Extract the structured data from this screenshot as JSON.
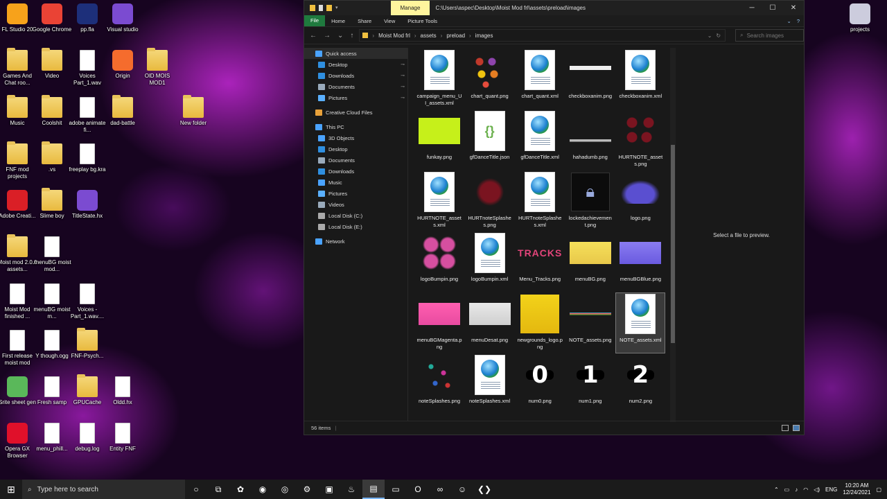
{
  "desktop": {
    "icons": [
      {
        "label": "FL Studio 20",
        "icon": "fl-studio-icon",
        "kind": "app",
        "color": "#f7a21b"
      },
      {
        "label": "Google Chrome",
        "icon": "chrome-icon",
        "kind": "app",
        "color": "#ea4335"
      },
      {
        "label": "pp.fla",
        "icon": "animate-file-icon",
        "kind": "app",
        "color": "#1d2f7a"
      },
      {
        "label": "Visual studio",
        "icon": "visual-studio-icon",
        "kind": "app",
        "color": "#7b4bd1"
      },
      {
        "label": "Games And Chat roo...",
        "icon": "folder-icon",
        "kind": "folder"
      },
      {
        "label": "Video",
        "icon": "folder-icon",
        "kind": "folder"
      },
      {
        "label": "Voices Part_1.wav",
        "icon": "audio-file-icon",
        "kind": "file"
      },
      {
        "label": "Origin",
        "icon": "origin-icon",
        "kind": "app",
        "color": "#f56c2d"
      },
      {
        "label": "OlD MOIS MOD1",
        "icon": "folder-icon",
        "kind": "folder"
      },
      {
        "label": "Music",
        "icon": "folder-icon",
        "kind": "folder"
      },
      {
        "label": "Coolshit",
        "icon": "folder-icon",
        "kind": "folder"
      },
      {
        "label": "adobe animate fi...",
        "icon": "animate-file-icon",
        "kind": "file"
      },
      {
        "label": "dad-battle",
        "icon": "folder-icon",
        "kind": "folder"
      },
      {
        "label": "New folder",
        "icon": "folder-icon",
        "kind": "folder"
      },
      {
        "label": "FNF mod projects",
        "icon": "folder-icon",
        "kind": "folder"
      },
      {
        "label": ".vs",
        "icon": "folder-icon",
        "kind": "folder"
      },
      {
        "label": "freeplay bg.kra",
        "icon": "krita-file-icon",
        "kind": "file"
      },
      {
        "label": "Adobe Creati...",
        "icon": "creative-cloud-icon",
        "kind": "app",
        "color": "#da1f26"
      },
      {
        "label": "Slime boy",
        "icon": "folder-icon",
        "kind": "folder"
      },
      {
        "label": "TitleState.hx",
        "icon": "vs-file-icon",
        "kind": "app",
        "color": "#7b4bd1"
      },
      {
        "label": "Moist mod 2.0.0 assets...",
        "icon": "folder-icon",
        "kind": "folder"
      },
      {
        "label": ".menuBG moist mod...",
        "icon": "krita-file-icon",
        "kind": "file"
      },
      {
        "label": "Moist Mod finished ...",
        "icon": "animate-file-icon",
        "kind": "file"
      },
      {
        "label": "menuBG moist m...",
        "icon": "krita-file-icon",
        "kind": "file"
      },
      {
        "label": "Voices - Part_1.wav....",
        "icon": "file-icon",
        "kind": "file"
      },
      {
        "label": "First release moist mod",
        "icon": "animate-file-icon",
        "kind": "file"
      },
      {
        "label": "Y though.ogg",
        "icon": "audio-file-icon",
        "kind": "file"
      },
      {
        "label": "FNF-Psych...",
        "icon": "folder-icon",
        "kind": "folder"
      },
      {
        "label": "Srite sheet gen",
        "icon": "sprite-sheet-icon",
        "kind": "app",
        "color": "#5ab85a"
      },
      {
        "label": "Fresh samp",
        "icon": "audio-file-icon",
        "kind": "file"
      },
      {
        "label": "GPUCache",
        "icon": "folder-icon",
        "kind": "folder"
      },
      {
        "label": "Oldd.hx",
        "icon": "archive-icon",
        "kind": "file"
      },
      {
        "label": "Opera GX Browser",
        "icon": "opera-gx-icon",
        "kind": "app",
        "color": "#e0102a"
      },
      {
        "label": "menu_phill...",
        "icon": "krita-file-icon",
        "kind": "file"
      },
      {
        "label": "debug.log",
        "icon": "text-file-icon",
        "kind": "file"
      },
      {
        "label": "Entity FNF",
        "icon": "archive-icon",
        "kind": "file"
      },
      {
        "label": "projects",
        "icon": "recycle-bin-icon",
        "kind": "app",
        "color": "#ccd"
      }
    ]
  },
  "explorer": {
    "manage_tab": "Manage",
    "path_title": "C:\\Users\\aspec\\Desktop\\Moist Mod frl\\assets\\preload\\images",
    "ribbon_tabs": [
      "File",
      "Home",
      "Share",
      "View",
      "Picture Tools"
    ],
    "breadcrumbs": [
      "Moist Mod frl",
      "assets",
      "preload",
      "images"
    ],
    "search_placeholder": "Search images",
    "nav": [
      {
        "label": "Quick access",
        "icon": "star-icon",
        "color": "#4aa3ff",
        "indent": 1,
        "pinned": false,
        "selected": true
      },
      {
        "label": "Desktop",
        "icon": "desktop-icon",
        "color": "#2f8fe0",
        "indent": 2,
        "pinned": true
      },
      {
        "label": "Downloads",
        "icon": "download-icon",
        "color": "#2f8fe0",
        "indent": 2,
        "pinned": true
      },
      {
        "label": "Documents",
        "icon": "document-icon",
        "color": "#9ab",
        "indent": 2,
        "pinned": true
      },
      {
        "label": "Pictures",
        "icon": "pictures-icon",
        "color": "#5ab0ff",
        "indent": 2,
        "pinned": true
      },
      {
        "label": "",
        "icon": "",
        "color": "",
        "indent": 0,
        "pinned": false
      },
      {
        "label": "Creative Cloud Files",
        "icon": "creative-cloud-icon",
        "color": "#e8a13a",
        "indent": 1,
        "pinned": false
      },
      {
        "label": "",
        "icon": "",
        "color": "",
        "indent": 0,
        "pinned": false
      },
      {
        "label": "This PC",
        "icon": "computer-icon",
        "color": "#4aa3ff",
        "indent": 1,
        "pinned": false
      },
      {
        "label": "3D Objects",
        "icon": "cube-icon",
        "color": "#4aa3ff",
        "indent": 2,
        "pinned": false
      },
      {
        "label": "Desktop",
        "icon": "desktop-icon",
        "color": "#2f8fe0",
        "indent": 2,
        "pinned": false
      },
      {
        "label": "Documents",
        "icon": "document-icon",
        "color": "#9ab",
        "indent": 2,
        "pinned": false
      },
      {
        "label": "Downloads",
        "icon": "download-icon",
        "color": "#2f8fe0",
        "indent": 2,
        "pinned": false
      },
      {
        "label": "Music",
        "icon": "music-icon",
        "color": "#4aa3ff",
        "indent": 2,
        "pinned": false
      },
      {
        "label": "Pictures",
        "icon": "pictures-icon",
        "color": "#5ab0ff",
        "indent": 2,
        "pinned": false
      },
      {
        "label": "Videos",
        "icon": "video-icon",
        "color": "#9ab",
        "indent": 2,
        "pinned": false
      },
      {
        "label": "Local Disk (C:)",
        "icon": "disk-icon",
        "color": "#aaa",
        "indent": 2,
        "pinned": false
      },
      {
        "label": "Local Disk (E:)",
        "icon": "disk-icon",
        "color": "#aaa",
        "indent": 2,
        "pinned": false
      },
      {
        "label": "",
        "icon": "",
        "color": "",
        "indent": 0,
        "pinned": false
      },
      {
        "label": "Network",
        "icon": "network-icon",
        "color": "#4aa3ff",
        "indent": 1,
        "pinned": false
      }
    ],
    "files": [
      {
        "name": "campaign_menu_UI_assets.xml",
        "kind": "xml"
      },
      {
        "name": "chart_quant.png",
        "kind": "png",
        "look": "dots"
      },
      {
        "name": "chart_quant.xml",
        "kind": "xml"
      },
      {
        "name": "checkboxanim.png",
        "kind": "png",
        "look": "checks"
      },
      {
        "name": "checkboxanim.xml",
        "kind": "xml"
      },
      {
        "name": "funkay.png",
        "kind": "png",
        "look": "funkay"
      },
      {
        "name": "gfDanceTitle.json",
        "kind": "json"
      },
      {
        "name": "gfDanceTitle.xml",
        "kind": "xml"
      },
      {
        "name": "hahadumb.png",
        "kind": "png",
        "look": "bar"
      },
      {
        "name": "HURTNOTE_assets.png",
        "kind": "png",
        "look": "hurt"
      },
      {
        "name": "HURTNOTE_assets.xml",
        "kind": "xml"
      },
      {
        "name": "HURTnoteSplashes.png",
        "kind": "png",
        "look": "hurtsplash"
      },
      {
        "name": "HURTnoteSplashes.xml",
        "kind": "xml"
      },
      {
        "name": "lockedachievement.png",
        "kind": "png",
        "look": "lock"
      },
      {
        "name": "logo.png",
        "kind": "png",
        "look": "logo"
      },
      {
        "name": "logoBumpin.png",
        "kind": "png",
        "look": "logos"
      },
      {
        "name": "logoBumpin.xml",
        "kind": "xml"
      },
      {
        "name": "Menu_Tracks.png",
        "kind": "png",
        "look": "tracks"
      },
      {
        "name": "menuBG.png",
        "kind": "png",
        "look": "yellow"
      },
      {
        "name": "menuBGBlue.png",
        "kind": "png",
        "look": "blue"
      },
      {
        "name": "menuBGMagenta.png",
        "kind": "png",
        "look": "magenta"
      },
      {
        "name": "menuDesat.png",
        "kind": "png",
        "look": "desat"
      },
      {
        "name": "newgrounds_logo.png",
        "kind": "png",
        "look": "newgrounds"
      },
      {
        "name": "NOTE_assets.png",
        "kind": "png",
        "look": "notes"
      },
      {
        "name": "NOTE_assets.xml",
        "kind": "xml",
        "selected": true
      },
      {
        "name": "noteSplashes.png",
        "kind": "png",
        "look": "splash"
      },
      {
        "name": "noteSplashes.xml",
        "kind": "xml"
      },
      {
        "name": "num0.png",
        "kind": "png",
        "look": "num0"
      },
      {
        "name": "num1.png",
        "kind": "png",
        "look": "num1"
      },
      {
        "name": "num2.png",
        "kind": "png",
        "look": "num2"
      }
    ],
    "tracks_text": "TRACKS",
    "num_glyphs": {
      "num0": "0",
      "num1": "1",
      "num2": "2"
    },
    "preview_text": "Select a file to preview.",
    "status_text": "56 items",
    "window_controls": [
      "─",
      "☐",
      "✕"
    ]
  },
  "taskbar": {
    "search_placeholder": "Type here to search",
    "apps": [
      {
        "icon": "cortana-icon",
        "glyph": "○"
      },
      {
        "icon": "task-view-icon",
        "glyph": "⧉"
      },
      {
        "icon": "fl-studio-icon",
        "glyph": "✿"
      },
      {
        "icon": "origin-icon",
        "glyph": "◉"
      },
      {
        "icon": "chrome-icon",
        "glyph": "◎"
      },
      {
        "icon": "settings-icon",
        "glyph": "⚙"
      },
      {
        "icon": "sprite-sheet-icon",
        "glyph": "▣"
      },
      {
        "icon": "steam-icon",
        "glyph": "♨"
      },
      {
        "icon": "file-explorer-icon",
        "glyph": "▤",
        "active": true
      },
      {
        "icon": "terminal-icon",
        "glyph": "▭"
      },
      {
        "icon": "opera-gx-icon",
        "glyph": "O"
      },
      {
        "icon": "visual-studio-icon",
        "glyph": "∞"
      },
      {
        "icon": "discord-icon",
        "glyph": "☺"
      },
      {
        "icon": "vscode-icon",
        "glyph": "❮❯"
      }
    ],
    "lang": "ENG",
    "time": "10:20 AM",
    "date": "12/24/2021"
  }
}
